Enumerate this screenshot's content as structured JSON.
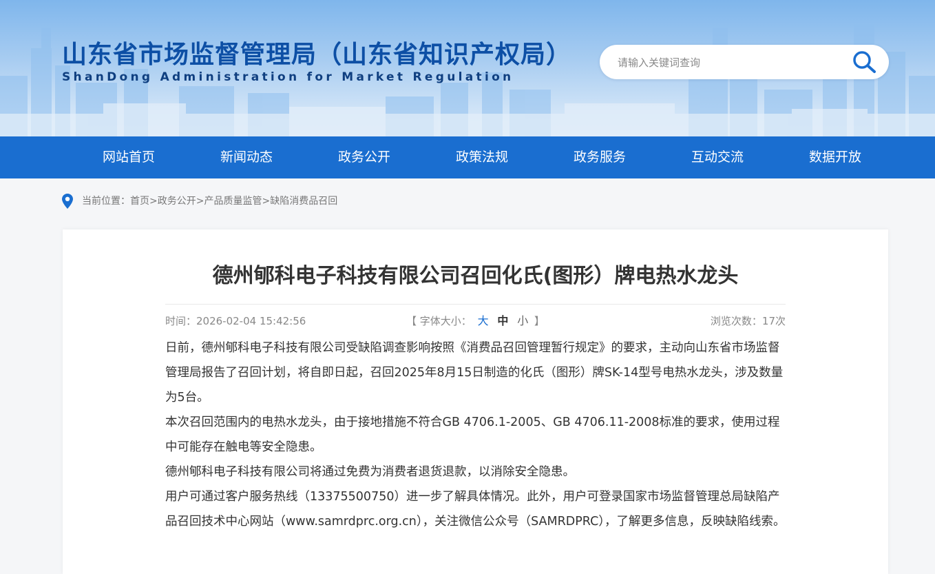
{
  "header": {
    "title": "山东省市场监督管理局（山东省知识产权局）",
    "subtitle": "ShanDong Administration for Market Regulation",
    "search": {
      "placeholder": "请输入关键词查询",
      "value": ""
    }
  },
  "nav": {
    "items": [
      {
        "label": "网站首页"
      },
      {
        "label": "新闻动态"
      },
      {
        "label": "政务公开"
      },
      {
        "label": "政策法规"
      },
      {
        "label": "政务服务"
      },
      {
        "label": "互动交流"
      },
      {
        "label": "数据开放"
      }
    ]
  },
  "breadcrumb": {
    "prefix": "当前位置：",
    "items": [
      "首页",
      "政务公开",
      "产品质量监管",
      "缺陷消费品召回"
    ],
    "separator": ">"
  },
  "article": {
    "title": "德州郇科电子科技有限公司召回化氏(图形）牌电热水龙头",
    "time": "时间：2026-02-04 15:42:56",
    "font_size": {
      "open": "【",
      "label": "字体大小：",
      "large": "大",
      "medium": "中",
      "small": "小",
      "close": "】"
    },
    "views": "浏览次数：17次",
    "paragraphs": [
      "日前，德州郇科电子科技有限公司受缺陷调查影响按照《消费品召回管理暂行规定》的要求，主动向山东省市场监督管理局报告了召回计划，将自即日起，召回2025年8月15日制造的化氏（图形）牌SK-14型号电热水龙头，涉及数量为5台。",
      "本次召回范围内的电热水龙头，由于接地措施不符合GB 4706.1-2005、GB 4706.11-2008标准的要求，使用过程中可能存在触电等安全隐患。",
      "德州郇科电子科技有限公司将通过免费为消费者退货退款，以消除安全隐患。",
      "用户可通过客户服务热线（13375500750）进一步了解具体情况。此外，用户可登录国家市场监督管理总局缺陷产品召回技术中心网站（www.samrdprc.org.cn），关注微信公众号（SAMRDPRC），了解更多信息，反映缺陷线索。"
    ]
  },
  "colors": {
    "nav_bg": "#1a6ed0",
    "title_blue": "#0d4fa5",
    "accent_blue": "#1a6ed0",
    "text": "#333333",
    "muted": "#888888"
  },
  "icons": {
    "search": "search-icon",
    "location": "location-pin-icon"
  }
}
